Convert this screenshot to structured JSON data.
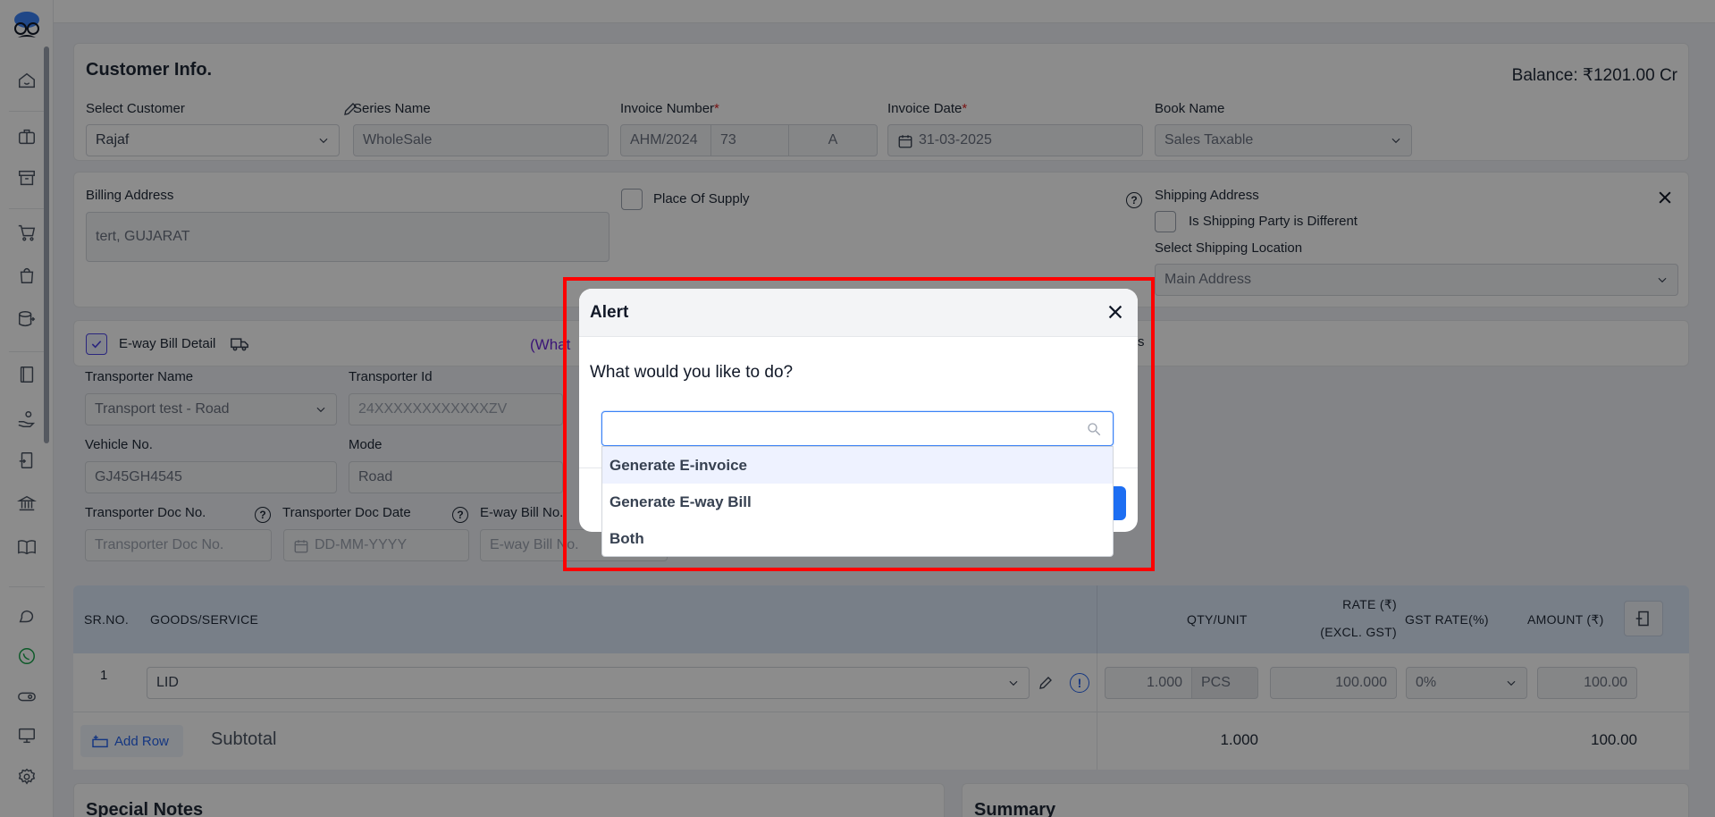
{
  "customer_info": {
    "title": "Customer Info.",
    "balance": "Balance: ₹1201.00 Cr",
    "select_customer_label": "Select Customer",
    "select_customer_value": "Rajaf",
    "series_name_label": "Series Name",
    "series_name_value": "WholeSale",
    "invoice_number_label": "Invoice Number",
    "invoice_prefix": "AHM/2024",
    "invoice_no": "73",
    "invoice_suffix": "A",
    "invoice_date_label": "Invoice Date",
    "invoice_date_value": "31-03-2025",
    "book_name_label": "Book Name",
    "book_name_value": "Sales Taxable",
    "required_mark": "*"
  },
  "address": {
    "billing_label": "Billing Address",
    "billing_value": "tert, GUJARAT",
    "place_of_supply_label": "Place Of Supply",
    "shipping_label": "Shipping Address",
    "shipping_different_label": "Is Shipping Party is Different",
    "shipping_location_label": "Select Shipping Location",
    "shipping_location_value": "Main Address"
  },
  "eway": {
    "detail_label": "E-way Bill Detail",
    "what_link": "(What",
    "trailing_text": "s",
    "transporter_name_label": "Transporter Name",
    "transporter_name_value": "Transport test - Road",
    "transporter_id_label": "Transporter Id",
    "transporter_id_placeholder": "24XXXXXXXXXXXXZV",
    "vehicle_no_label": "Vehicle No.",
    "vehicle_no_value": "GJ45GH4545",
    "mode_label": "Mode",
    "mode_value": "Road",
    "doc_no_label": "Transporter Doc No.",
    "doc_no_placeholder": "Transporter Doc No.",
    "doc_date_label": "Transporter Doc Date",
    "doc_date_placeholder": "DD-MM-YYYY",
    "eway_no_label": "E-way Bill No.",
    "eway_no_placeholder": "E-way Bill No."
  },
  "items_table": {
    "headers": {
      "sr": "SR.NO.",
      "goods": "GOODS/SERVICE",
      "qty": "QTY/UNIT",
      "rate_line1": "RATE (₹)",
      "rate_line2": "(EXCL. GST)",
      "gst": "GST RATE(%)",
      "amount": "AMOUNT (₹)"
    },
    "rows": [
      {
        "sr": "1",
        "item": "LID",
        "qty": "1.000",
        "unit": "PCS",
        "rate": "100.000",
        "gst": "0%",
        "amount": "100.00"
      }
    ],
    "add_row_label": "Add Row",
    "subtotal_label": "Subtotal",
    "subtotal_qty": "1.000",
    "subtotal_amount": "100.00"
  },
  "bottom": {
    "special_notes_title": "Special Notes",
    "summary_title": "Summary"
  },
  "modal": {
    "title": "Alert",
    "message": "What would you like to do?",
    "search_placeholder": "",
    "options": [
      "Generate E-invoice",
      "Generate E-way Bill",
      "Both"
    ],
    "highlighted_option": "Generate E-invoice"
  },
  "colors": {
    "accent": "#1d6ef2",
    "highlight_border": "#ff0000",
    "required": "#dc2626",
    "link_purple": "#6d28d9",
    "whatsapp": "#16a34a"
  }
}
